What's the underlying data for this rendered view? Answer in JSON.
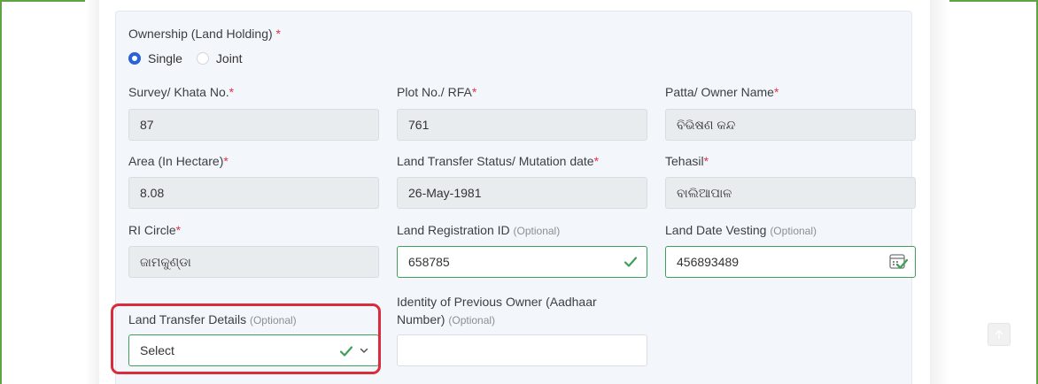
{
  "ownership": {
    "label": "Ownership (Land Holding)",
    "required_mark": "*",
    "options": [
      {
        "label": "Single",
        "selected": true
      },
      {
        "label": "Joint",
        "selected": false
      }
    ]
  },
  "fields": {
    "survey": {
      "label": "Survey/ Khata No.",
      "required_mark": "*",
      "value": "87"
    },
    "plot": {
      "label": "Plot No./ RFA",
      "required_mark": "*",
      "value": "761"
    },
    "patta": {
      "label": "Patta/ Owner Name",
      "required_mark": "*",
      "value": "ବିଭିଷଣ କନ୍ଦ"
    },
    "area": {
      "label": "Area (In Hectare)",
      "required_mark": "*",
      "value": "8.08"
    },
    "mutation": {
      "label": "Land Transfer Status/ Mutation date",
      "required_mark": "*",
      "value": "26-May-1981"
    },
    "tehasil": {
      "label": "Tehasil",
      "required_mark": "*",
      "value": "ବାଲିଆପାଳ"
    },
    "ri_circle": {
      "label": "RI Circle",
      "required_mark": "*",
      "value": "ଜାମକୁଣ୍ଡା"
    },
    "registration": {
      "label": "Land Registration ID",
      "optional": "(Optional)",
      "value": "658785"
    },
    "vesting": {
      "label": "Land Date Vesting",
      "optional": "(Optional)",
      "value": "456893489"
    },
    "transfer_details": {
      "label": "Land Transfer Details",
      "optional": "(Optional)",
      "value": "Select"
    },
    "previous_owner": {
      "label_line1": "Identity of Previous Owner (Aadhaar",
      "label_line2": "Number)",
      "optional": "(Optional)",
      "value": ""
    }
  },
  "colors": {
    "accent": "#2a62d8",
    "valid": "#3f9f5a",
    "required": "#e0334c",
    "highlight": "#d92c3c",
    "frame": "#5fa343"
  },
  "icons": {
    "valid": "check-icon",
    "calendar": "calendar-icon",
    "dropdown": "chevron-down-icon",
    "scroll": "arrow-up-icon"
  }
}
